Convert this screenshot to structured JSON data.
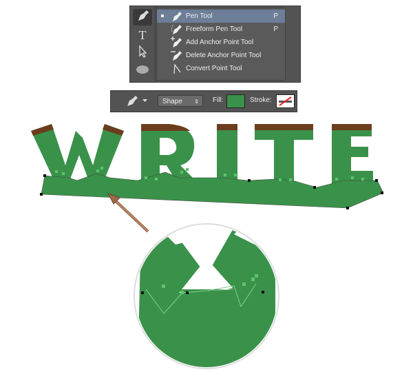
{
  "tools_panel": {
    "tools": [
      {
        "icon": "pen-icon"
      },
      {
        "icon": "type-icon",
        "glyph": "T"
      },
      {
        "icon": "path-selection-icon"
      },
      {
        "icon": "ellipse-icon"
      }
    ],
    "menu": [
      {
        "label": "Pen Tool",
        "shortcut": "P",
        "icon": "pen-icon",
        "selected": true
      },
      {
        "label": "Freeform Pen Tool",
        "shortcut": "P",
        "icon": "freeform-pen-icon"
      },
      {
        "label": "Add Anchor Point Tool",
        "shortcut": "",
        "icon": "add-anchor-icon"
      },
      {
        "label": "Delete Anchor Point Tool",
        "shortcut": "",
        "icon": "delete-anchor-icon"
      },
      {
        "label": "Convert Point Tool",
        "shortcut": "",
        "icon": "convert-point-icon"
      }
    ]
  },
  "options_bar": {
    "mode": "Shape",
    "fill_label": "Fill:",
    "stroke_label": "Stroke:",
    "fill_color": "#3a924a"
  },
  "colors": {
    "letter_green": "#3a924a",
    "soil_brown": "#6b3d1c",
    "arrow": "#a0694a",
    "anchor_green": "#5cc46e"
  }
}
